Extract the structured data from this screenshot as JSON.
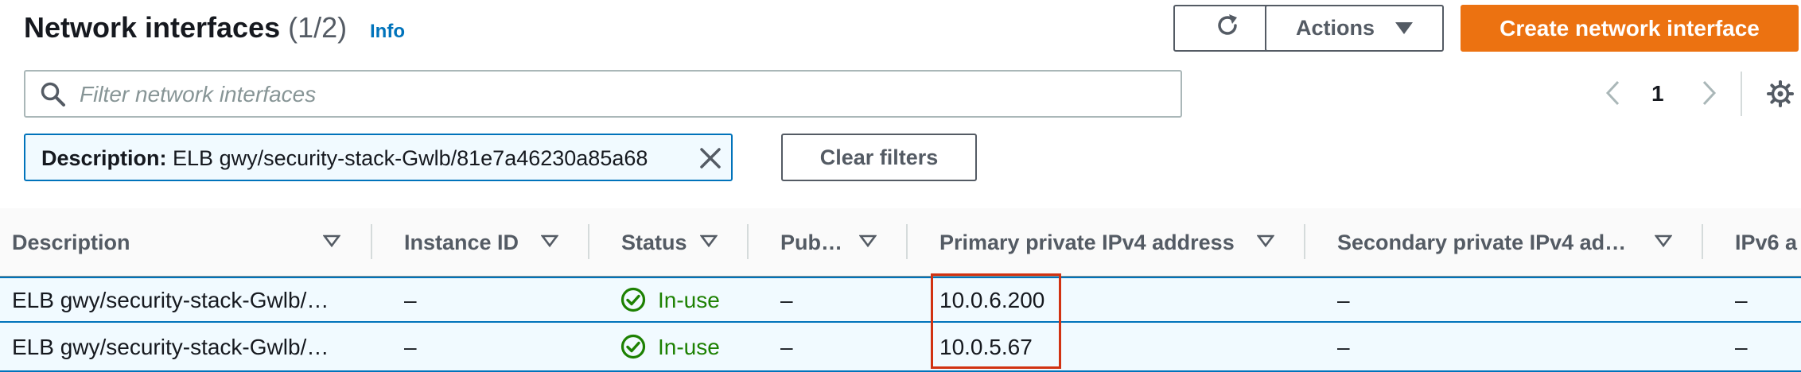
{
  "header": {
    "title": "Network interfaces",
    "count": "(1/2)",
    "info_link": "Info",
    "refresh_icon": "refresh-icon",
    "actions_label": "Actions",
    "create_label": "Create network interface"
  },
  "search": {
    "placeholder": "Filter network interfaces",
    "value": ""
  },
  "pagination": {
    "current_page": "1"
  },
  "filter": {
    "key": "Description:",
    "value": " ELB gwy/security-stack-Gwlb/81e7a46230a85a68",
    "clear_label": "Clear filters"
  },
  "table": {
    "columns": [
      "Description",
      "Instance ID",
      "Status",
      "Pub…",
      "Primary private IPv4 address",
      "Secondary private IPv4 ad…",
      "IPv6 a"
    ],
    "rows": [
      {
        "description": "ELB gwy/security-stack-Gwlb/…",
        "instance_id": "–",
        "status": "In-use",
        "public": "–",
        "primary_ipv4": "10.0.6.200",
        "secondary_ipv4": "–",
        "ipv6": "–"
      },
      {
        "description": "ELB gwy/security-stack-Gwlb/…",
        "instance_id": "–",
        "status": "In-use",
        "public": "–",
        "primary_ipv4": "10.0.5.67",
        "secondary_ipv4": "–",
        "ipv6": "–"
      }
    ]
  },
  "colors": {
    "accent_orange": "#ec7211",
    "link_blue": "#0073bb",
    "status_green": "#1d8102",
    "selected_row_bg": "#f1faff",
    "highlight_red": "#d13212"
  }
}
